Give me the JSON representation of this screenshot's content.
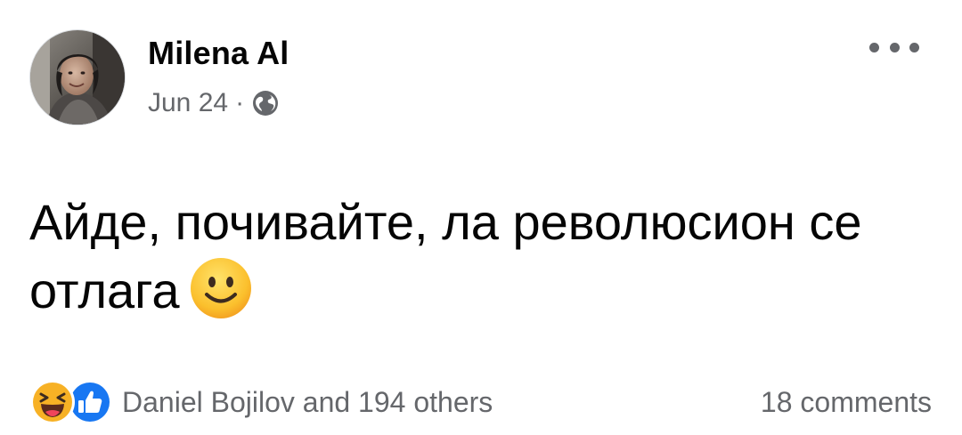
{
  "post": {
    "author": {
      "name": "Milena Al",
      "avatar_icon": "profile-photo-avatar"
    },
    "meta": {
      "date": "Jun 24",
      "separator": "·",
      "privacy_icon": "globe-icon"
    },
    "more_icon": "more-options-icon",
    "text": "Айде, почивайте, ла революсион се отлага",
    "emoji": "slightly-smiling-face-icon",
    "reactions": {
      "icons": [
        "haha-reaction-icon",
        "like-reaction-icon"
      ],
      "summary": "Daniel Bojilov and 194 others"
    },
    "comments": "18 comments"
  },
  "colors": {
    "primary_text": "#050505",
    "secondary_text": "#65676b",
    "like_blue": "#1877f2",
    "haha_yellow": "#f7b125",
    "background": "#ffffff"
  }
}
